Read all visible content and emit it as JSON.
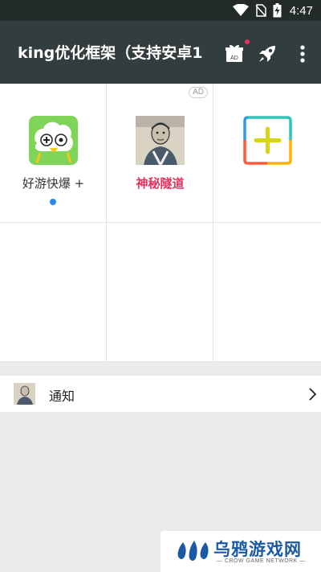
{
  "status_bar": {
    "time": "4:47"
  },
  "app_bar": {
    "title": "king优化框架（支持安卓1",
    "gift_badge": "AD"
  },
  "grid": {
    "ad_badge": "AD",
    "items": [
      {
        "label": "好游快爆 +",
        "color": "#333333"
      },
      {
        "label": "神秘隧道",
        "color": "#e8315c"
      }
    ]
  },
  "notice": {
    "label": "通知"
  },
  "watermark": {
    "title": "乌鸦游戏网",
    "subtitle": "— CROW GAME NETWORK —"
  }
}
